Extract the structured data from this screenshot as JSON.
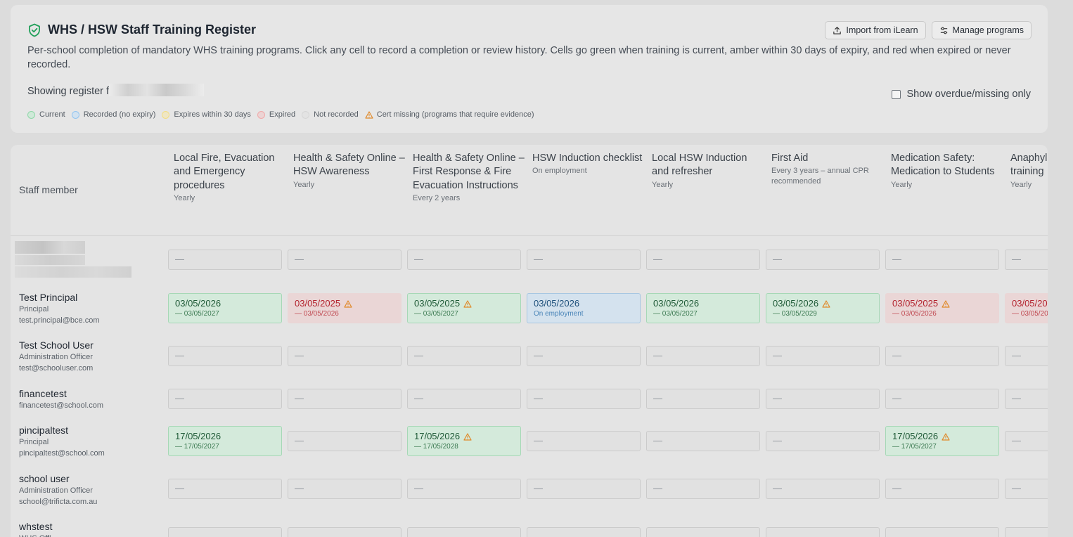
{
  "header": {
    "title": "WHS / HSW Staff Training Register",
    "description": "Per-school completion of mandatory WHS training programs. Click any cell to record a completion or review history. Cells go green when training is current, amber within 30 days of expiry, and red when expired or never recorded.",
    "showing_prefix": "Showing register f",
    "import_label": "Import from iLearn",
    "manage_label": "Manage programs",
    "overdue_label": "Show overdue/missing only"
  },
  "legend": [
    {
      "label": "Current",
      "color": "#8fd7a8"
    },
    {
      "label": "Recorded (no expiry)",
      "color": "#93c5f0"
    },
    {
      "label": "Expires within 30 days",
      "color": "#f3dd83"
    },
    {
      "label": "Expired",
      "color": "#f0a9a9"
    },
    {
      "label": "Not recorded",
      "color": "#d6d6d6"
    },
    {
      "label": "Cert missing (programs that require evidence)",
      "color": "#e08a2b"
    }
  ],
  "table": {
    "staff_header": "Staff member",
    "columns": [
      {
        "name": "Local Fire, Evacuation and Emergency procedures",
        "freq": "Yearly"
      },
      {
        "name": "Health & Safety Online – HSW Awareness",
        "freq": "Yearly"
      },
      {
        "name": "Health & Safety Online – First Response & Fire Evacuation Instructions",
        "freq": "Every 2 years"
      },
      {
        "name": "HSW Induction checklist",
        "freq": "On employment"
      },
      {
        "name": "Local HSW Induction and refresher",
        "freq": "Yearly"
      },
      {
        "name": "First Aid",
        "freq": "Every 3 years – annual CPR recommended"
      },
      {
        "name": "Medication Safety: Medication to Students",
        "freq": "Yearly"
      },
      {
        "name": "Anaphylaxis training",
        "freq": "Yearly"
      }
    ],
    "empty_mark": "—",
    "staff": [
      {
        "name": "Test Principal",
        "role": "Principal",
        "email": "test.principal@bce.com"
      },
      {
        "name": "Test School User",
        "role": "Administration Officer",
        "email": "test@schooluser.com"
      },
      {
        "name": "financetest",
        "role": "",
        "email": "financetest@school.com"
      },
      {
        "name": "pincipaltest",
        "role": "Principal",
        "email": "pincipaltest@school.com"
      },
      {
        "name": "school user",
        "role": "Administration Officer",
        "email": "school@trificta.com.au"
      },
      {
        "name": "whstest",
        "role": "WHS Offi",
        "email": ""
      }
    ],
    "records": {
      "tp_c0": {
        "date": "03/05/2026",
        "sub": "— 03/05/2027"
      },
      "tp_c1": {
        "date": "03/05/2025",
        "sub": "— 03/05/2026"
      },
      "tp_c2": {
        "date": "03/05/2025",
        "sub": "— 03/05/2027"
      },
      "tp_c3": {
        "date": "03/05/2026",
        "sub": "On employment"
      },
      "tp_c4": {
        "date": "03/05/2026",
        "sub": "— 03/05/2027"
      },
      "tp_c5": {
        "date": "03/05/2026",
        "sub": "— 03/05/2029"
      },
      "tp_c6": {
        "date": "03/05/2025",
        "sub": "— 03/05/2026"
      },
      "tp_c7": {
        "date": "03/05/20",
        "sub": "— 03/05/20"
      },
      "pt_c0": {
        "date": "17/05/2026",
        "sub": "— 17/05/2027"
      },
      "pt_c2": {
        "date": "17/05/2026",
        "sub": "— 17/05/2028"
      },
      "pt_c6": {
        "date": "17/05/2026",
        "sub": "— 17/05/2027"
      }
    }
  }
}
